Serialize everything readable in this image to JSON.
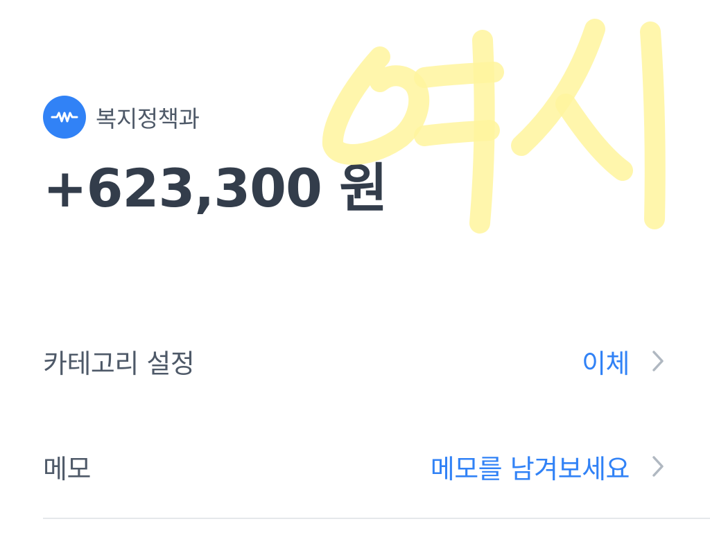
{
  "transaction": {
    "sender_name": "복지정책과",
    "amount": "+623,300 원"
  },
  "details": {
    "category_label": "카테고리 설정",
    "category_value": "이체",
    "memo_label": "메모",
    "memo_placeholder": "메모를 남겨보세요"
  },
  "annotation": {
    "handwritten_text": "여시"
  },
  "colors": {
    "accent": "#3182f6",
    "title_text": "#333d4b",
    "label_text": "#4e5968",
    "chevron": "#b0b8c1",
    "highlighter": "#fff176"
  }
}
